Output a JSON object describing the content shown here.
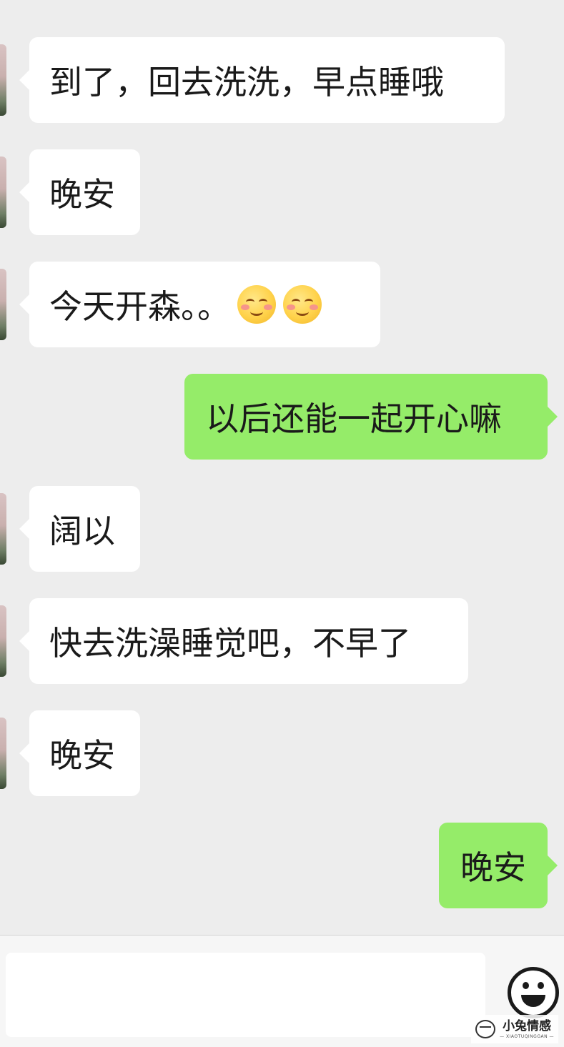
{
  "messages": [
    {
      "side": "in",
      "text": "到了，回去洗洗，早点睡哦"
    },
    {
      "side": "in",
      "text": "晚安"
    },
    {
      "side": "in",
      "text": "今天开森。。",
      "emoji": [
        "smiling-blush-emoji",
        "smiling-blush-emoji"
      ]
    },
    {
      "side": "out",
      "text": "以后还能一起开心嘛"
    },
    {
      "side": "in",
      "text": "阔以"
    },
    {
      "side": "in",
      "text": "快去洗澡睡觉吧，不早了"
    },
    {
      "side": "in",
      "text": "晚安"
    },
    {
      "side": "out",
      "text": "晚安"
    }
  ],
  "input_bar": {
    "value": "",
    "emoji_button_icon": "smiley-face-icon"
  },
  "watermark": {
    "main": "小兔情感",
    "sub": "— XIAOTUQINGGAN —"
  },
  "colors": {
    "background": "#ededed",
    "incoming_bubble": "#ffffff",
    "outgoing_bubble": "#95ec69"
  }
}
